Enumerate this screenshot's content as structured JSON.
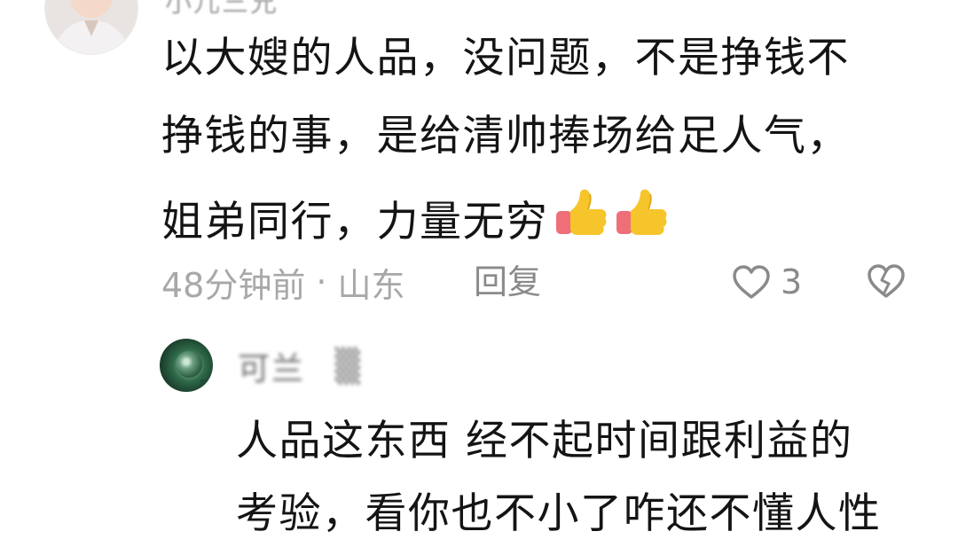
{
  "comment_1": {
    "username": "小儿三兄",
    "text_lines": [
      "以大嫂的人品，没问题，不是挣钱不",
      "挣钱的事，是给清帅捧场给足人气，",
      "姐弟同行，力量无穷"
    ],
    "emoji": [
      "thumbs-up",
      "thumbs-up"
    ],
    "time": "48分钟前",
    "dot": "·",
    "location": "山东",
    "reply_label": "回复",
    "like_count": "3"
  },
  "comment_2": {
    "username_part_1": "可兰",
    "username_part_2": "▒",
    "text_lines": [
      "人品这东西 经不起时间跟利益的",
      "考验，看你也不小了咋还不懂人性"
    ]
  },
  "colors": {
    "text": "#141414",
    "meta": "#a8a8a8",
    "action": "#8a8a8a",
    "thumb_yellow": "#f6c52b",
    "thumb_sleeve": "#ef6f78"
  }
}
